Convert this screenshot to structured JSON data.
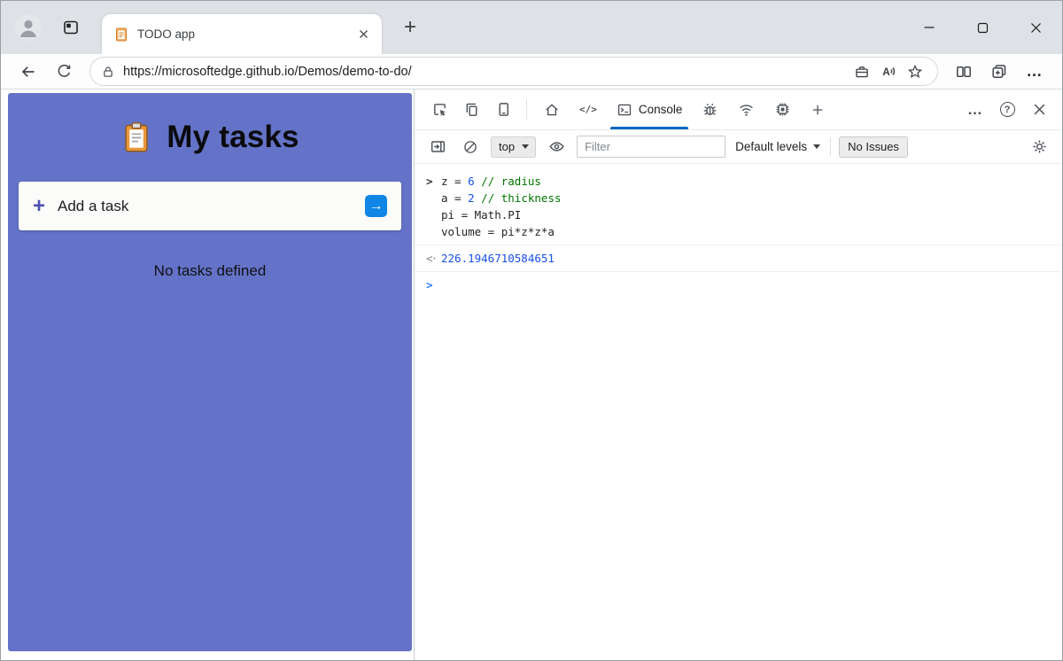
{
  "colors": {
    "titlebar_bg": "#dee1e6",
    "app_purple": "#6473c7",
    "edge_blue": "#0067c0",
    "submit_blue": "#0f86e6",
    "plus_indigo": "#4d51b0",
    "number_blue": "#1750eb",
    "comment_green": "#007400",
    "prompt_blue": "#2979ff",
    "result_blue": "#1750eb"
  },
  "browser": {
    "tab_title": "TODO app",
    "url": "https://microsoftedge.github.io/Demos/demo-to-do/"
  },
  "app": {
    "title": "My tasks",
    "add_task_label": "Add a task",
    "empty_message": "No tasks defined"
  },
  "devtools": {
    "console_tab_label": "Console",
    "toolbar": {
      "context": "top",
      "filter_placeholder": "Filter",
      "levels_label": "Default levels",
      "issues_label": "No Issues"
    },
    "console": {
      "lines": [
        {
          "segments": [
            {
              "text": "z = ",
              "type": "plain"
            },
            {
              "text": "6",
              "type": "number"
            },
            {
              "text": " ",
              "type": "plain"
            },
            {
              "text": "// radius",
              "type": "comment"
            }
          ]
        },
        {
          "segments": [
            {
              "text": "a = ",
              "type": "plain"
            },
            {
              "text": "2",
              "type": "number"
            },
            {
              "text": " ",
              "type": "plain"
            },
            {
              "text": "// thickness",
              "type": "comment"
            }
          ]
        },
        {
          "segments": [
            {
              "text": "pi = Math.PI",
              "type": "plain"
            }
          ]
        },
        {
          "segments": [
            {
              "text": "volume = pi*z*z*a",
              "type": "plain"
            }
          ]
        }
      ],
      "result": "226.1946710584651"
    }
  },
  "icons": {
    "new_tab_plus": "+",
    "add_task_plus": "+",
    "submit_arrow": "→",
    "more_dots": "…",
    "help_question": "?",
    "elements_glyph": "</>",
    "input_chevron": ">",
    "prompt_chevron": ">",
    "result_arrow": "<·"
  }
}
